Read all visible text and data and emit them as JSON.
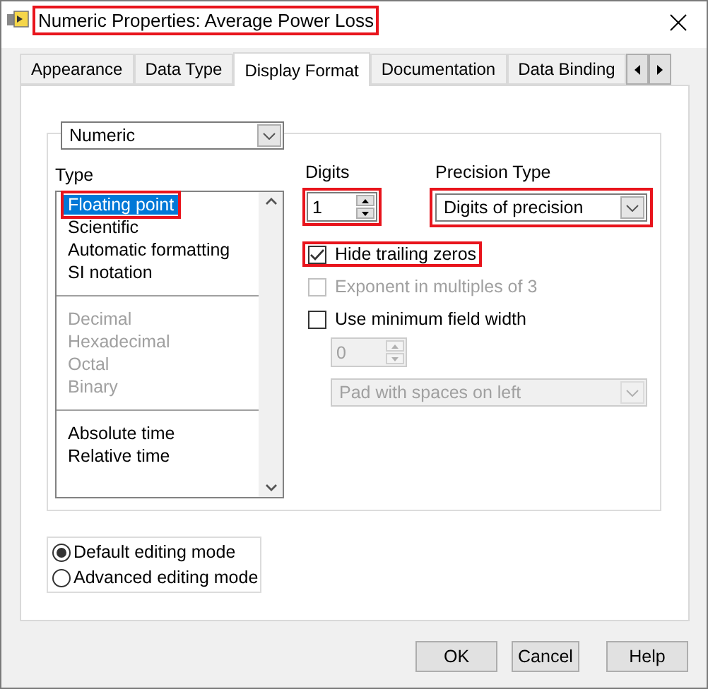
{
  "window": {
    "title": "Numeric Properties: Average Power Loss",
    "title_highlighted": true
  },
  "tabs": [
    {
      "label": "Appearance",
      "selected": false
    },
    {
      "label": "Data Type",
      "selected": false
    },
    {
      "label": "Display Format",
      "selected": true
    },
    {
      "label": "Documentation",
      "selected": false
    },
    {
      "label": "Data Binding",
      "selected": false
    }
  ],
  "format_dropdown": {
    "value": "Numeric"
  },
  "type_list": {
    "label": "Type",
    "groups": [
      [
        {
          "label": "Floating point",
          "selected": true,
          "disabled": false,
          "highlighted": true
        },
        {
          "label": "Scientific",
          "selected": false,
          "disabled": false,
          "highlighted": false
        },
        {
          "label": "Automatic formatting",
          "selected": false,
          "disabled": false,
          "highlighted": false
        },
        {
          "label": "SI notation",
          "selected": false,
          "disabled": false,
          "highlighted": false
        }
      ],
      [
        {
          "label": "Decimal",
          "selected": false,
          "disabled": true,
          "highlighted": false
        },
        {
          "label": "Hexadecimal",
          "selected": false,
          "disabled": true,
          "highlighted": false
        },
        {
          "label": "Octal",
          "selected": false,
          "disabled": true,
          "highlighted": false
        },
        {
          "label": "Binary",
          "selected": false,
          "disabled": true,
          "highlighted": false
        }
      ],
      [
        {
          "label": "Absolute time",
          "selected": false,
          "disabled": false,
          "highlighted": false
        },
        {
          "label": "Relative time",
          "selected": false,
          "disabled": false,
          "highlighted": false
        }
      ]
    ]
  },
  "digits": {
    "label": "Digits",
    "value": "1",
    "highlighted": true
  },
  "precision_type": {
    "label": "Precision Type",
    "value": "Digits of precision",
    "highlighted": true
  },
  "options": [
    {
      "label": "Hide trailing zeros",
      "checked": true,
      "disabled": false,
      "highlighted": true
    },
    {
      "label": "Exponent in multiples of 3",
      "checked": false,
      "disabled": true,
      "highlighted": false
    },
    {
      "label": "Use minimum field width",
      "checked": false,
      "disabled": false,
      "highlighted": false
    }
  ],
  "min_width": {
    "value": "0",
    "disabled": true
  },
  "padding": {
    "value": "Pad with spaces on left",
    "disabled": true
  },
  "editing_modes": [
    {
      "label": "Default editing mode",
      "selected": true
    },
    {
      "label": "Advanced editing mode",
      "selected": false
    }
  ],
  "buttons": [
    "OK",
    "Cancel",
    "Help"
  ]
}
